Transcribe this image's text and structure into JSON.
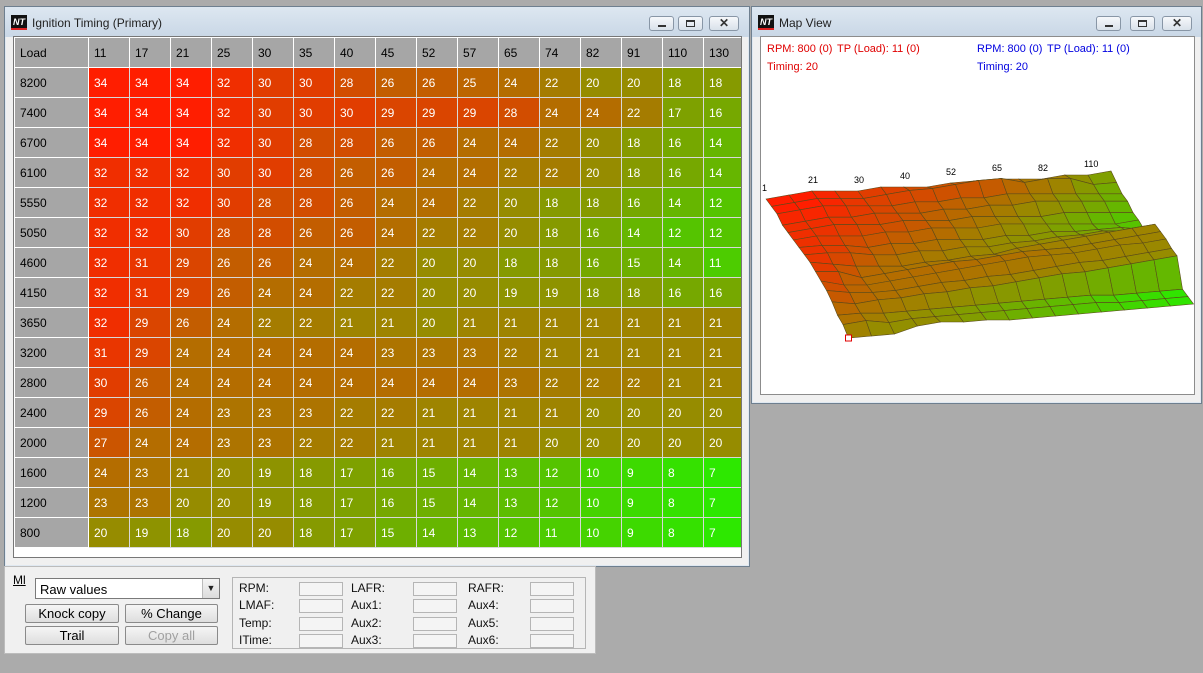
{
  "timing_window": {
    "title": "Ignition Timing (Primary)",
    "corner_label": "Load",
    "columns": [
      "11",
      "17",
      "21",
      "25",
      "30",
      "35",
      "40",
      "45",
      "52",
      "57",
      "65",
      "74",
      "82",
      "91",
      "110",
      "130"
    ],
    "rows": [
      {
        "label": "8200",
        "values": [
          "34",
          "34",
          "34",
          "32",
          "30",
          "30",
          "28",
          "26",
          "26",
          "25",
          "24",
          "22",
          "20",
          "20",
          "18",
          "18"
        ]
      },
      {
        "label": "7400",
        "values": [
          "34",
          "34",
          "34",
          "32",
          "30",
          "30",
          "30",
          "29",
          "29",
          "29",
          "28",
          "24",
          "24",
          "22",
          "17",
          "16"
        ]
      },
      {
        "label": "6700",
        "values": [
          "34",
          "34",
          "34",
          "32",
          "30",
          "28",
          "28",
          "26",
          "26",
          "24",
          "24",
          "22",
          "20",
          "18",
          "16",
          "14"
        ]
      },
      {
        "label": "6100",
        "values": [
          "32",
          "32",
          "32",
          "30",
          "30",
          "28",
          "26",
          "26",
          "24",
          "24",
          "22",
          "22",
          "20",
          "18",
          "16",
          "14"
        ]
      },
      {
        "label": "5550",
        "values": [
          "32",
          "32",
          "32",
          "30",
          "28",
          "28",
          "26",
          "24",
          "24",
          "22",
          "20",
          "18",
          "18",
          "16",
          "14",
          "12"
        ]
      },
      {
        "label": "5050",
        "values": [
          "32",
          "32",
          "30",
          "28",
          "28",
          "26",
          "26",
          "24",
          "22",
          "22",
          "20",
          "18",
          "16",
          "14",
          "12",
          "12"
        ]
      },
      {
        "label": "4600",
        "values": [
          "32",
          "31",
          "29",
          "26",
          "26",
          "24",
          "24",
          "22",
          "20",
          "20",
          "18",
          "18",
          "16",
          "15",
          "14",
          "11"
        ]
      },
      {
        "label": "4150",
        "values": [
          "32",
          "31",
          "29",
          "26",
          "24",
          "24",
          "22",
          "22",
          "20",
          "20",
          "19",
          "19",
          "18",
          "18",
          "16",
          "16"
        ]
      },
      {
        "label": "3650",
        "values": [
          "32",
          "29",
          "26",
          "24",
          "22",
          "22",
          "21",
          "21",
          "20",
          "21",
          "21",
          "21",
          "21",
          "21",
          "21",
          "21"
        ]
      },
      {
        "label": "3200",
        "values": [
          "31",
          "29",
          "24",
          "24",
          "24",
          "24",
          "24",
          "23",
          "23",
          "23",
          "22",
          "21",
          "21",
          "21",
          "21",
          "21"
        ]
      },
      {
        "label": "2800",
        "values": [
          "30",
          "26",
          "24",
          "24",
          "24",
          "24",
          "24",
          "24",
          "24",
          "24",
          "23",
          "22",
          "22",
          "22",
          "21",
          "21"
        ]
      },
      {
        "label": "2400",
        "values": [
          "29",
          "26",
          "24",
          "23",
          "23",
          "23",
          "22",
          "22",
          "21",
          "21",
          "21",
          "21",
          "20",
          "20",
          "20",
          "20"
        ]
      },
      {
        "label": "2000",
        "values": [
          "27",
          "24",
          "24",
          "23",
          "23",
          "22",
          "22",
          "21",
          "21",
          "21",
          "21",
          "20",
          "20",
          "20",
          "20",
          "20"
        ]
      },
      {
        "label": "1600",
        "values": [
          "24",
          "23",
          "21",
          "20",
          "19",
          "18",
          "17",
          "16",
          "15",
          "14",
          "13",
          "12",
          "10",
          "9",
          "8",
          "7"
        ]
      },
      {
        "label": "1200",
        "values": [
          "23",
          "23",
          "20",
          "20",
          "19",
          "18",
          "17",
          "16",
          "15",
          "14",
          "13",
          "12",
          "10",
          "9",
          "8",
          "7"
        ]
      },
      {
        "label": "800",
        "values": [
          "20",
          "19",
          "18",
          "20",
          "20",
          "18",
          "17",
          "15",
          "14",
          "13",
          "12",
          "11",
          "10",
          "9",
          "8",
          "7"
        ]
      }
    ]
  },
  "map_window": {
    "title": "Map View",
    "left_info": {
      "rpm": "RPM: 800 (0)",
      "tp": "TP (Load): 11 (0)",
      "timing": "Timing: 20"
    },
    "right_info": {
      "rpm": "RPM: 800 (0)",
      "tp": "TP (Load): 11 (0)",
      "timing": "Timing: 20"
    },
    "axis_labels": [
      "1",
      "21",
      "30",
      "40",
      "52",
      "65",
      "82",
      "110"
    ]
  },
  "control_panel": {
    "ml_label": "Ml",
    "view_mode": "Raw values",
    "buttons": {
      "knock_copy": "Knock copy",
      "percent_change": "% Change",
      "trail": "Trail",
      "copy_all": "Copy all"
    },
    "readouts": [
      {
        "label": "RPM:"
      },
      {
        "label": "LAFR:"
      },
      {
        "label": "RAFR:"
      },
      {
        "label": "LMAF:"
      },
      {
        "label": "Aux1:"
      },
      {
        "label": "Aux4:"
      },
      {
        "label": "Temp:"
      },
      {
        "label": "Aux2:"
      },
      {
        "label": "Aux5:"
      },
      {
        "label": "ITime:"
      },
      {
        "label": "Aux3:"
      },
      {
        "label": "Aux6:"
      }
    ]
  },
  "colors": {
    "high": "#ff1e00",
    "mid": "#9a8800",
    "low": "#2de800",
    "desktop": "#ababab"
  }
}
